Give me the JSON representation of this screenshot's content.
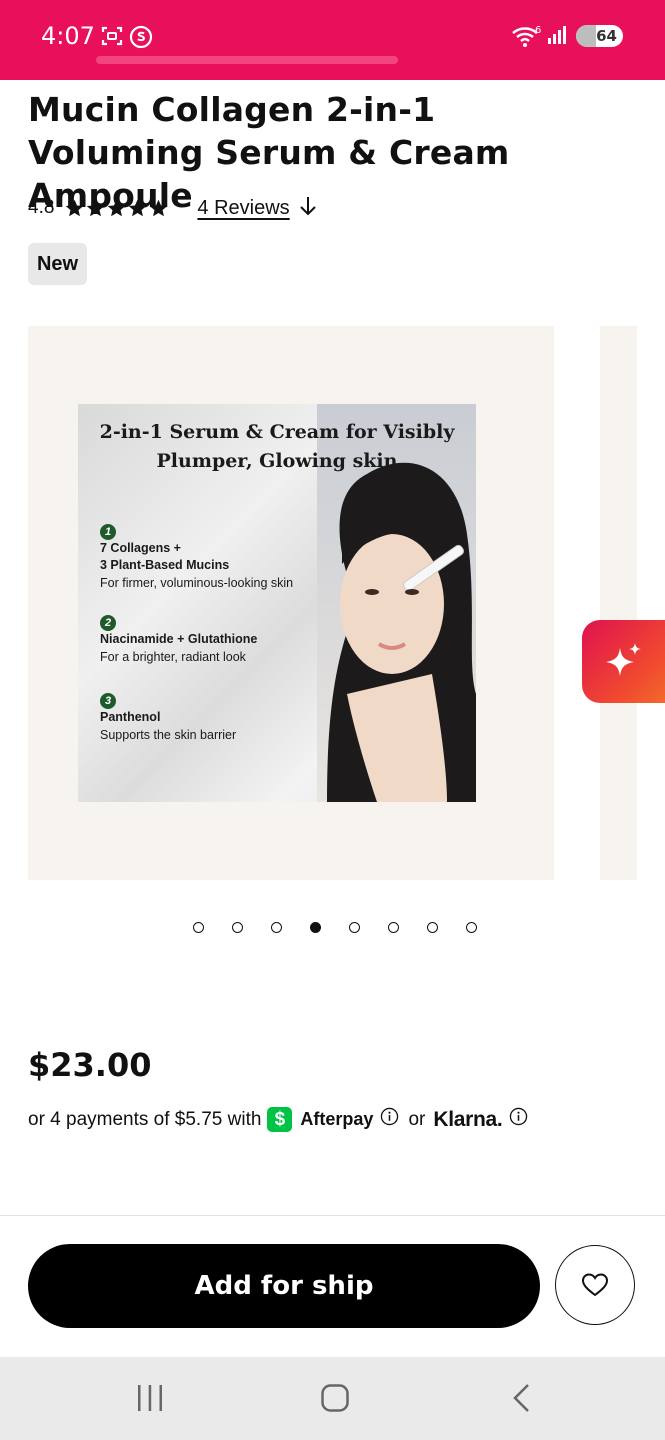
{
  "status_bar": {
    "time": "4:07",
    "battery": "64",
    "signal_label": "6"
  },
  "product": {
    "title": "Mucin Collagen 2-in-1 Voluming Serum & Cream Ampoule",
    "rating": "4.8",
    "rating_stars": 5,
    "reviews_label": "4 Reviews",
    "badge": "New"
  },
  "gallery": {
    "promo_heading": "2-in-1 Serum & Cream for Visibly Plumper, Glowing skin",
    "features": [
      {
        "num": "1",
        "title_line1": "7 Collagens +",
        "title_line2": "3 Plant-Based Mucins",
        "desc": "For firmer, voluminous-looking skin"
      },
      {
        "num": "2",
        "title_line1": "Niacinamide + Glutathione",
        "title_line2": "",
        "desc": "For a brighter, radiant look"
      },
      {
        "num": "3",
        "title_line1": "Panthenol",
        "title_line2": "",
        "desc": "Supports the skin barrier"
      }
    ],
    "dot_count": 8,
    "active_dot_index": 3
  },
  "pricing": {
    "price": "$23.00",
    "installments_text": "or 4 payments of $5.75 with",
    "afterpay_label": "Afterpay",
    "or_label": "or",
    "klarna_label": "Klarna."
  },
  "actions": {
    "add_button": "Add for ship"
  },
  "icons": [
    "screenshot-icon",
    "app-s-icon",
    "wifi-icon",
    "signal-icon",
    "battery-icon",
    "star-icon",
    "arrow-down-icon",
    "cash-app-icon",
    "info-icon",
    "heart-icon",
    "sparkle-icon",
    "recents-icon",
    "home-icon",
    "back-icon"
  ],
  "colors": {
    "status_bar": "#e8105a",
    "primary_button": "#000000",
    "cash_green": "#00c244",
    "fab_gradient_start": "#e0124f",
    "fab_gradient_end": "#f26a2a"
  }
}
